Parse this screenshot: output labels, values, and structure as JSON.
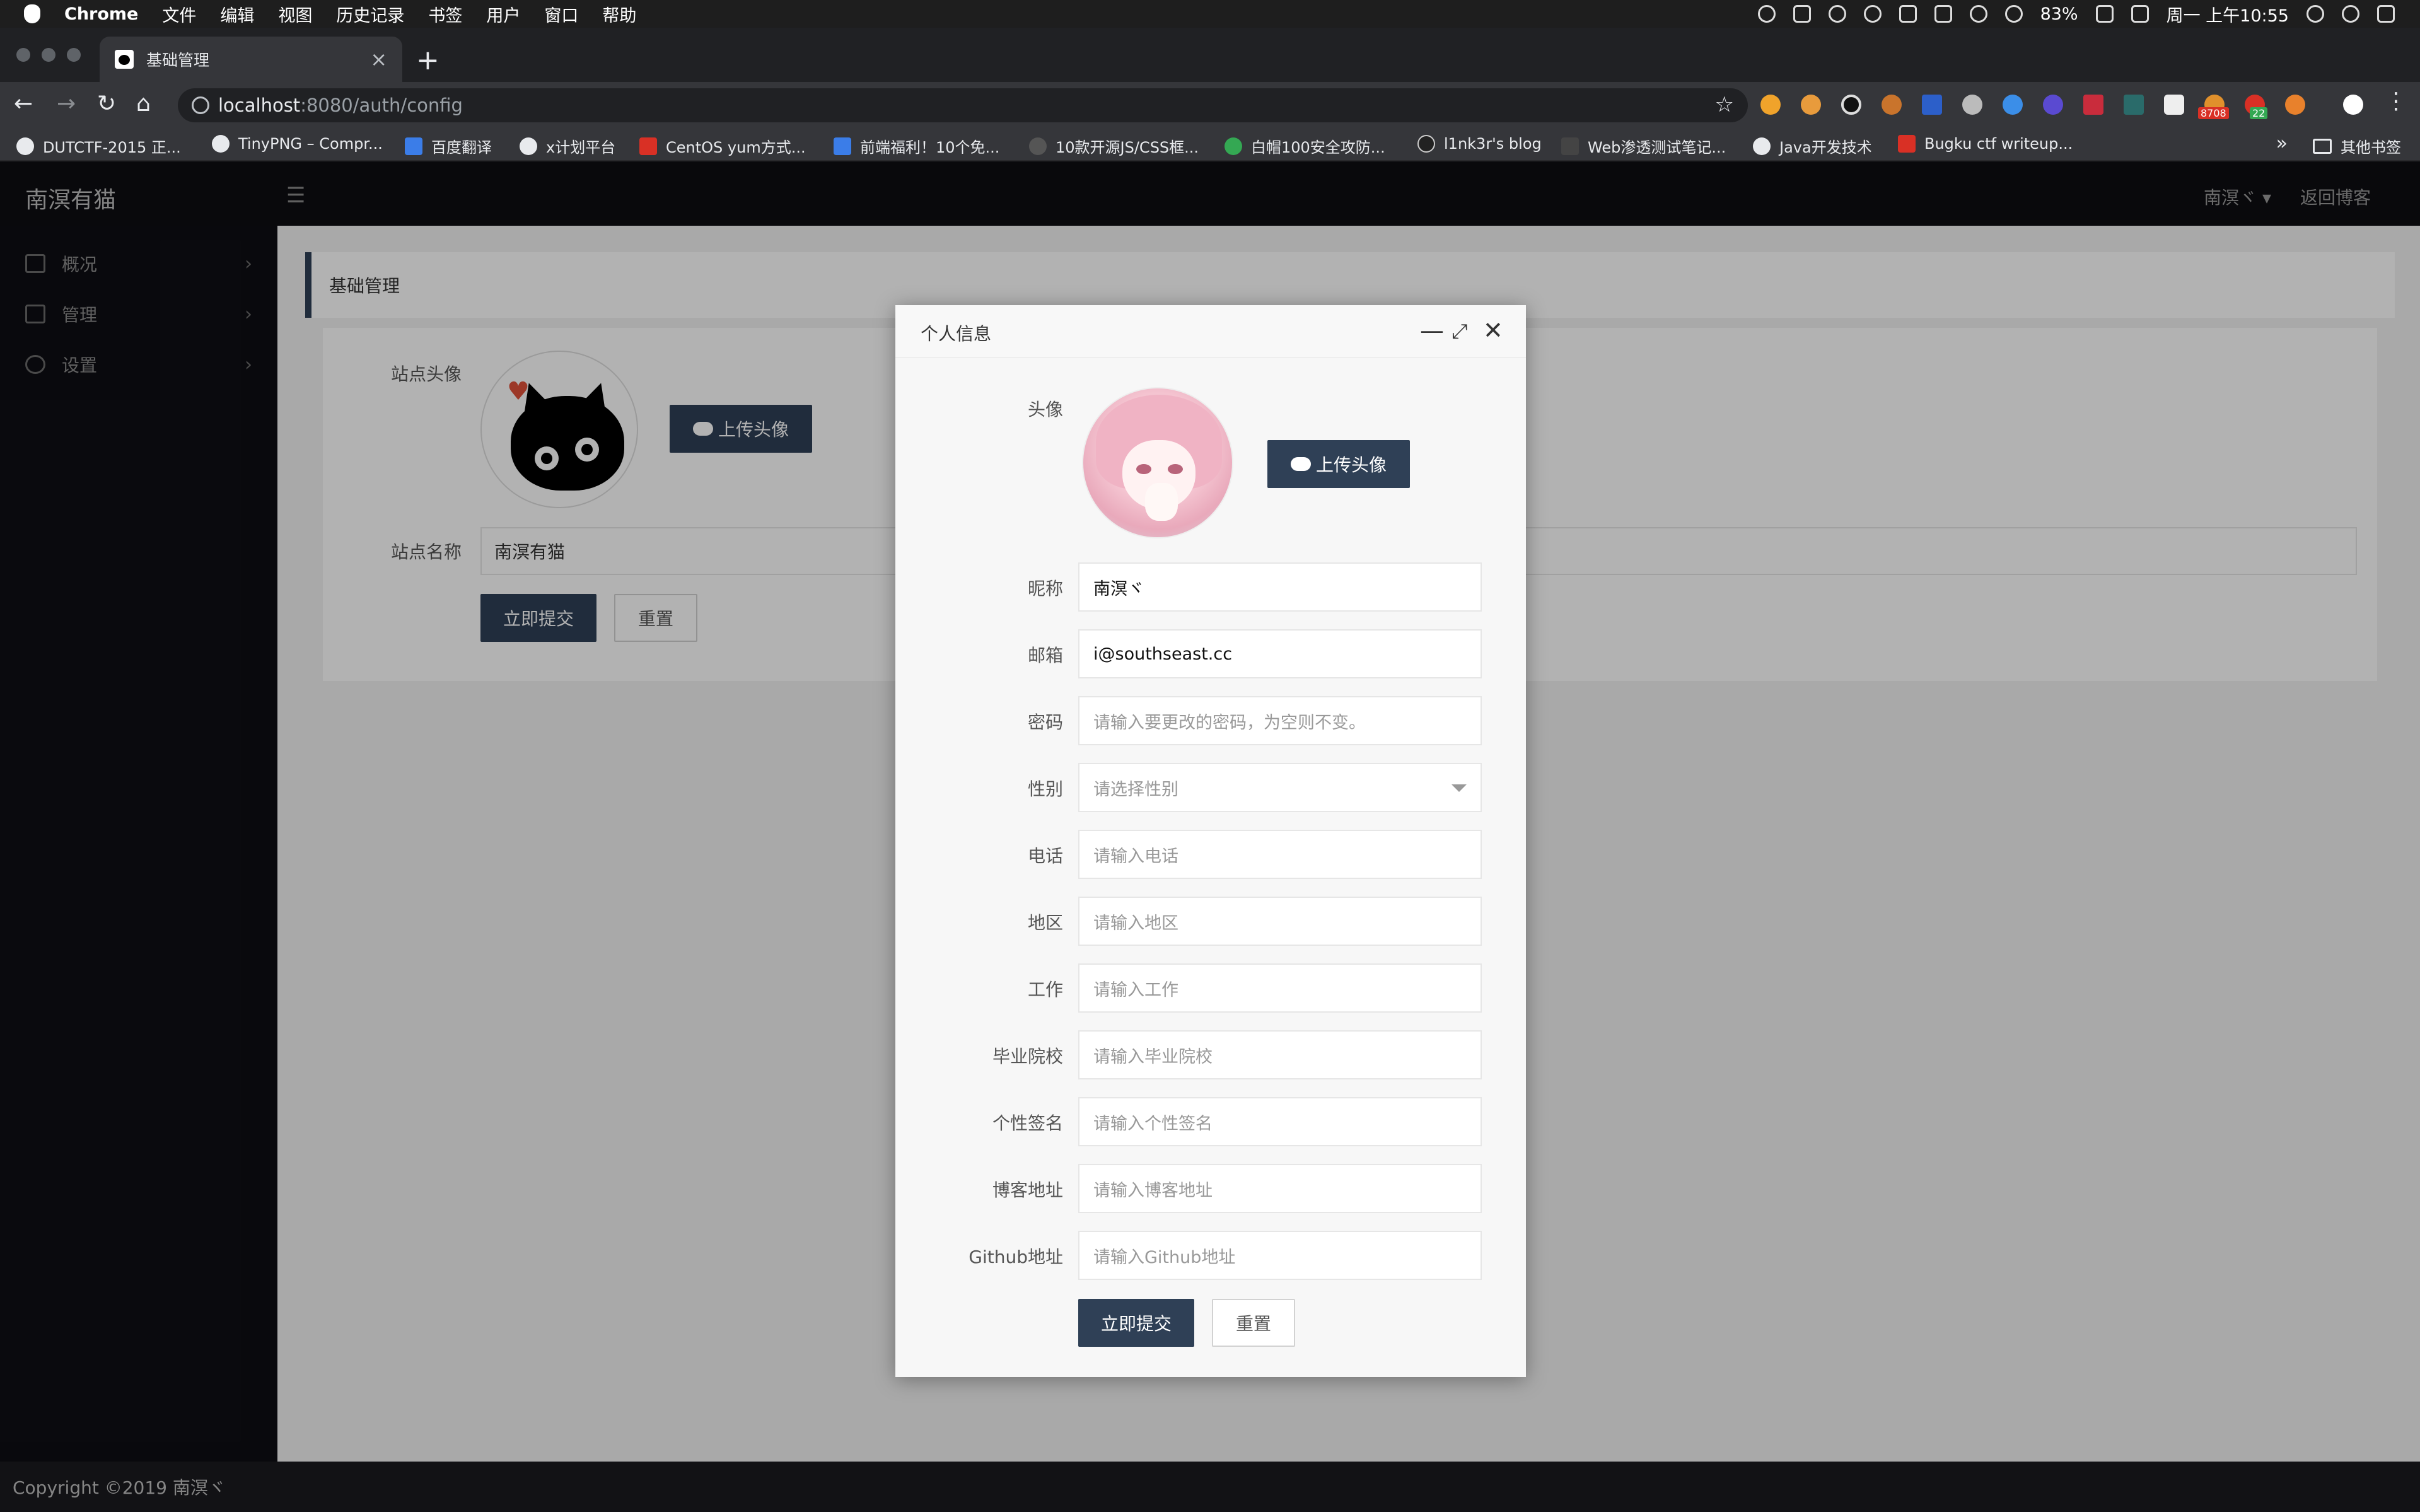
{
  "menubar": {
    "app_name": "Chrome",
    "menus": [
      "文件",
      "编辑",
      "视图",
      "历史记录",
      "书签",
      "用户",
      "窗口",
      "帮助"
    ],
    "battery": "83%",
    "datetime": "周一 上午10:55"
  },
  "browser": {
    "tab_title": "基础管理",
    "tab_close": "×",
    "new_tab": "+",
    "url_host": "localhost",
    "url_path": ":8080/auth/config",
    "ext_badge_1": "8708",
    "ext_badge_2": "22",
    "bookmarks": [
      "DUTCTF-2015 正...",
      "TinyPNG – Compr...",
      "百度翻译",
      "x计划平台",
      "CentOS yum方式...",
      "前端福利！10个免...",
      "10款开源JS/CSS框...",
      "白帽100安全攻防...",
      "l1nk3r's blog",
      "Web渗透测试笔记...",
      "Java开发技术",
      "Bugku ctf writeup..."
    ],
    "bookmarks_more": "»",
    "other_bookmarks": "其他书签"
  },
  "app": {
    "brand": "南溟有猫",
    "user_menu": "南溟ヾ",
    "back_to_blog": "返回博客",
    "sidebar": [
      {
        "label": "概况"
      },
      {
        "label": "管理"
      },
      {
        "label": "设置"
      }
    ],
    "breadcrumb": "基础管理",
    "form": {
      "avatar_label": "站点头像",
      "upload_label": "上传头像",
      "sitename_label": "站点名称",
      "sitename_value": "南溟有猫",
      "submit_label": "立即提交",
      "reset_label": "重置"
    },
    "footer": "Copyright ©2019 南溟ヾ"
  },
  "modal": {
    "title": "个人信息",
    "avatar_label": "头像",
    "upload_label": "上传头像",
    "fields": [
      {
        "label": "昵称",
        "value": "南溟ヾ",
        "placeholder": ""
      },
      {
        "label": "邮箱",
        "value": "i@southseast.cc",
        "placeholder": ""
      },
      {
        "label": "密码",
        "value": "",
        "placeholder": "请输入要更改的密码，为空则不变。"
      },
      {
        "label": "性别",
        "value": "",
        "placeholder": "请选择性别"
      },
      {
        "label": "电话",
        "value": "",
        "placeholder": "请输入电话"
      },
      {
        "label": "地区",
        "value": "",
        "placeholder": "请输入地区"
      },
      {
        "label": "工作",
        "value": "",
        "placeholder": "请输入工作"
      },
      {
        "label": "毕业院校",
        "value": "",
        "placeholder": "请输入毕业院校"
      },
      {
        "label": "个性签名",
        "value": "",
        "placeholder": "请输入个性签名"
      },
      {
        "label": "博客地址",
        "value": "",
        "placeholder": "请输入博客地址"
      },
      {
        "label": "Github地址",
        "value": "",
        "placeholder": "请输入Github地址"
      }
    ],
    "submit_label": "立即提交",
    "reset_label": "重置"
  },
  "colors": {
    "accent": "#2f4056",
    "sidebar_bg": "#0e0e14",
    "header_bg": "#0d0d12"
  }
}
